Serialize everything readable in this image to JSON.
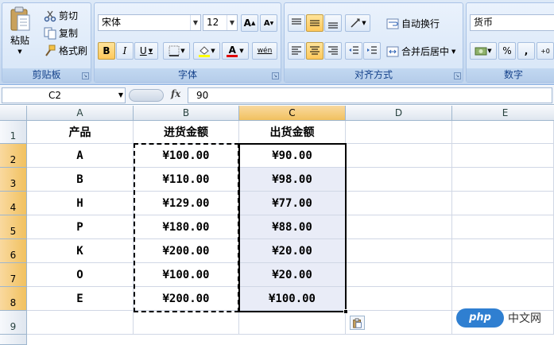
{
  "ribbon": {
    "clipboard": {
      "paste_label": "粘贴",
      "cut_label": "剪切",
      "copy_label": "复制",
      "format_painter_label": "格式刷",
      "group_label": "剪贴板"
    },
    "font": {
      "font_name": "宋体",
      "font_size": "12",
      "bold_label": "B",
      "italic_label": "I",
      "underline_label": "U",
      "group_label": "字体",
      "grow_label": "A",
      "shrink_label": "A",
      "font_color_label": "A",
      "phonetic_label": "wén"
    },
    "alignment": {
      "wrap_text_label": "自动换行",
      "merge_center_label": "合并后居中",
      "group_label": "对齐方式"
    },
    "number": {
      "format": "货币",
      "percent_label": "%",
      "comma_label": ",",
      "group_label": "数字"
    }
  },
  "formula_bar": {
    "name_box": "C2",
    "fx_label": "fx",
    "value": "90"
  },
  "sheet": {
    "columns": [
      "A",
      "B",
      "C",
      "D",
      "E"
    ],
    "rows": [
      "1",
      "2",
      "3",
      "4",
      "5",
      "6",
      "7",
      "8",
      "9"
    ],
    "headers": [
      "产品",
      "进货金额",
      "出货金额"
    ],
    "data": [
      [
        "A",
        "¥100.00",
        "¥90.00"
      ],
      [
        "B",
        "¥110.00",
        "¥98.00"
      ],
      [
        "H",
        "¥129.00",
        "¥77.00"
      ],
      [
        "P",
        "¥180.00",
        "¥88.00"
      ],
      [
        "K",
        "¥200.00",
        "¥20.00"
      ],
      [
        "O",
        "¥100.00",
        "¥20.00"
      ],
      [
        "E",
        "¥200.00",
        "¥100.00"
      ]
    ]
  },
  "watermark": {
    "logo": "php",
    "text": "中文网"
  }
}
